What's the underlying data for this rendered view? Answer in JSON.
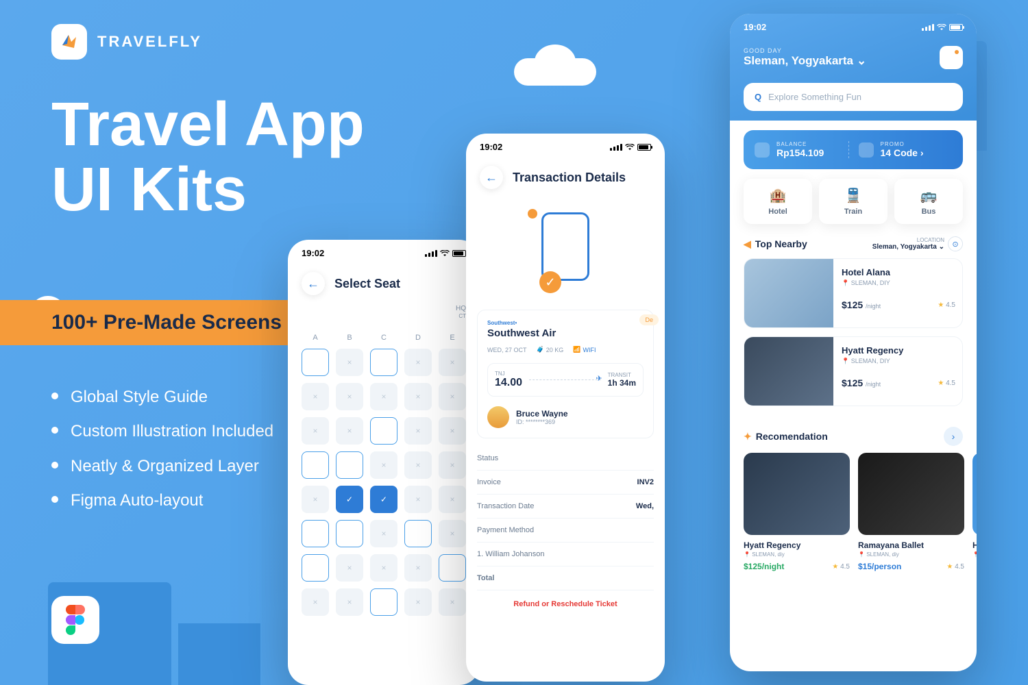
{
  "brand": "TRAVELFLY",
  "hero1": "Travel App",
  "hero2": "UI Kits",
  "banner": "100+ Pre-Made Screens",
  "bullets": [
    "Global Style Guide",
    "Custom Illustration Included",
    "Neatly & Organized Layer",
    "Figma Auto-layout"
  ],
  "time": "19:02",
  "seat": {
    "title": "Select Seat",
    "hq": "HQ",
    "ct": "CT",
    "cols": [
      "A",
      "B",
      "C",
      "D",
      "E"
    ]
  },
  "transaction": {
    "title": "Transaction Details",
    "airline_brand": "Southwest•",
    "airline": "Southwest Air",
    "pill": "De",
    "date": "WED, 27 OCT",
    "bag": "20 KG",
    "wifi": "WIFI",
    "from_code": "TNJ",
    "from_time": "14.00",
    "transit_l": "TRANSIT",
    "transit_v": "1h 34m",
    "pax": "Bruce Wayne",
    "pax_id": "ID: ********369",
    "rows": {
      "status": "Status",
      "invoice": "Invoice",
      "invoice_v": "INV2",
      "tdate": "Transaction Date",
      "tdate_v": "Wed,",
      "pmethod": "Payment Method",
      "p1": "1. William Johanson",
      "total": "Total"
    },
    "refund": "Refund or Reschedule Ticket"
  },
  "home": {
    "good": "GOOD DAY",
    "loc": "Sleman, Yogyakarta",
    "search": "Explore Something Fun",
    "bal_l": "BALANCE",
    "bal_v": "Rp154.109",
    "promo_l": "PROMO",
    "promo_v": "14 Code",
    "cats": [
      "Hotel",
      "Train",
      "Bus"
    ],
    "nearby": "Top Nearby",
    "loc_l": "LOCATION",
    "loc_v": "Sleman, Yogyakarta",
    "hotels": [
      {
        "name": "Hotel Alana",
        "loc": "SLEMAN, DIY",
        "price": "$125",
        "unit": "/night",
        "rating": "4.5"
      },
      {
        "name": "Hyatt Regency",
        "loc": "SLEMAN, DIY",
        "price": "$125",
        "unit": "/night",
        "rating": "4.5"
      }
    ],
    "rec": "Recomendation",
    "recs": [
      {
        "name": "Hyatt Regency",
        "loc": "SLEMAN, diy",
        "price": "$125/night",
        "rating": "4.5"
      },
      {
        "name": "Ramayana Ballet",
        "loc": "SLEMAN, diy",
        "price": "$15/person",
        "rating": "4.5"
      },
      {
        "name": "H",
        "loc": "S"
      }
    ]
  }
}
